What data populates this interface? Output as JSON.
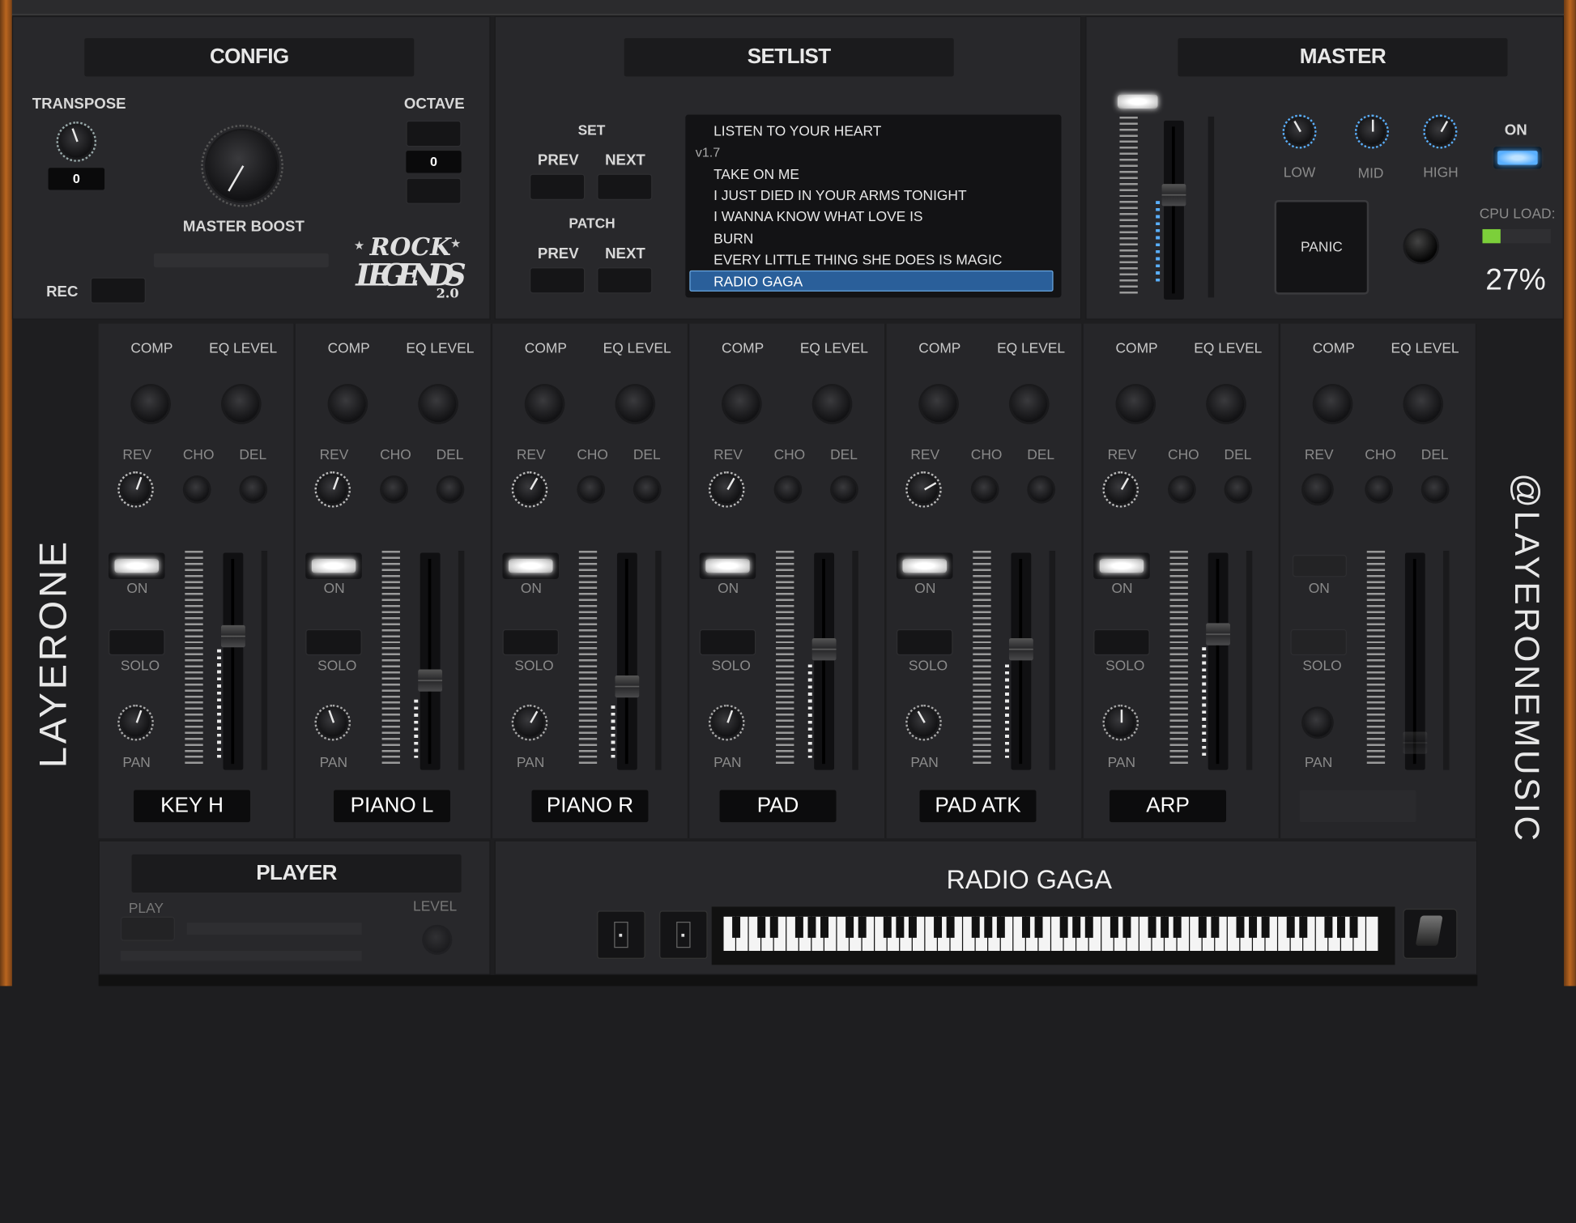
{
  "config": {
    "title": "CONFIG",
    "transpose_label": "TRANSPOSE",
    "transpose_value": "0",
    "octave_label": "OCTAVE",
    "octave_value": "0",
    "master_boost_label": "MASTER BOOST",
    "rec_label": "REC",
    "logo_text": "ROCK LEGENDS 2.0"
  },
  "setlist": {
    "title": "SETLIST",
    "set_label": "SET",
    "patch_label": "PATCH",
    "prev_label": "PREV",
    "next_label": "NEXT",
    "version": "v1.7",
    "items": [
      "LISTEN TO YOUR HEART",
      "TAKE ON ME",
      "I JUST DIED IN YOUR ARMS TONIGHT",
      "I WANNA KNOW WHAT LOVE IS",
      "BURN",
      "EVERY LITTLE THING SHE DOES IS MAGIC",
      "RADIO GAGA"
    ],
    "selected": "RADIO GAGA"
  },
  "master": {
    "title": "MASTER",
    "low_label": "LOW",
    "mid_label": "MID",
    "high_label": "HIGH",
    "on_label": "ON",
    "panic_label": "PANIC",
    "cpu_label": "CPU LOAD:",
    "cpu_value": "27%",
    "cpu_fraction": 0.27
  },
  "channel_labels": {
    "comp": "COMP",
    "eq_level": "EQ LEVEL",
    "rev": "REV",
    "cho": "CHO",
    "del": "DEL",
    "on": "ON",
    "solo": "SOLO",
    "pan": "PAN"
  },
  "channels": [
    {
      "name": "KEY H",
      "fader": 0.63
    },
    {
      "name": "PIANO L",
      "fader": 0.4
    },
    {
      "name": "PIANO R",
      "fader": 0.37
    },
    {
      "name": "PAD",
      "fader": 0.56
    },
    {
      "name": "PAD ATK",
      "fader": 0.56
    },
    {
      "name": "ARP",
      "fader": 0.64
    },
    {
      "name": "",
      "fader": 0.08
    }
  ],
  "side": {
    "left_brand": "LAYERONE",
    "right_brand": "@LAYERONEMUSIC"
  },
  "player": {
    "title": "PLAYER",
    "play_label": "PLAY",
    "level_label": "LEVEL"
  },
  "keyboard": {
    "song_title": "RADIO GAGA"
  },
  "colors": {
    "accent_blue": "#5ab0ff",
    "cpu_green": "#7ccf3a",
    "selected_bg": "#2a5f9a"
  }
}
